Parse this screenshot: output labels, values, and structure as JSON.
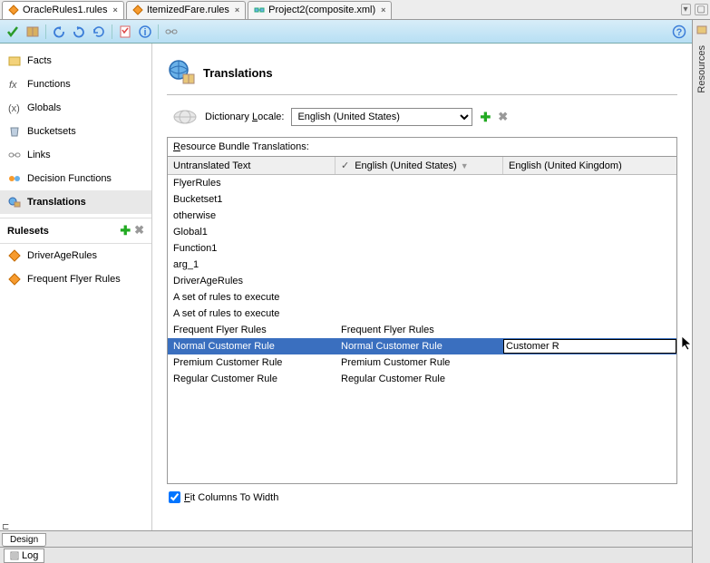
{
  "tabs": [
    {
      "label": "OracleRules1.rules",
      "active": true,
      "dirty": true,
      "icon": "rules"
    },
    {
      "label": "ItemizedFare.rules",
      "active": false,
      "dirty": false,
      "icon": "rules"
    },
    {
      "label": "Project2(composite.xml)",
      "active": false,
      "dirty": false,
      "icon": "composite"
    }
  ],
  "rightStrip": {
    "label": "Resources"
  },
  "leftNav": {
    "items": [
      {
        "label": "Facts",
        "icon": "facts"
      },
      {
        "label": "Functions",
        "icon": "functions"
      },
      {
        "label": "Globals",
        "icon": "globals"
      },
      {
        "label": "Bucketsets",
        "icon": "bucketsets"
      },
      {
        "label": "Links",
        "icon": "links"
      },
      {
        "label": "Decision Functions",
        "icon": "decisionfn"
      },
      {
        "label": "Translations",
        "icon": "translations",
        "selected": true
      }
    ],
    "rulesetsHeader": "Rulesets",
    "rulesets": [
      {
        "label": "DriverAgeRules"
      },
      {
        "label": "Frequent Flyer Rules"
      }
    ]
  },
  "content": {
    "title": "Translations",
    "localeLabel": "Dictionary Locale:",
    "localeSelected": "English (United States)",
    "tableTitle": "Resource Bundle Translations:",
    "titleMnemonic": "R",
    "columns": [
      "Untranslated Text",
      "English (United States)",
      "English (United Kingdom)"
    ],
    "checkedColumnIndex": 1,
    "rows": [
      {
        "c1": "FlyerRules",
        "c2": "",
        "c3": ""
      },
      {
        "c1": "Bucketset1",
        "c2": "",
        "c3": ""
      },
      {
        "c1": "otherwise",
        "c2": "",
        "c3": ""
      },
      {
        "c1": "Global1",
        "c2": "",
        "c3": ""
      },
      {
        "c1": "Function1",
        "c2": "",
        "c3": ""
      },
      {
        "c1": "arg_1",
        "c2": "",
        "c3": ""
      },
      {
        "c1": "DriverAgeRules",
        "c2": "",
        "c3": ""
      },
      {
        "c1": "A set of rules to execute",
        "c2": "",
        "c3": ""
      },
      {
        "c1": "A set of rules to execute",
        "c2": "",
        "c3": ""
      },
      {
        "c1": "Frequent Flyer Rules",
        "c2": "Frequent Flyer Rules",
        "c3": ""
      },
      {
        "c1": "Normal Customer Rule",
        "c2": "Normal Customer Rule",
        "c3": "Customer R",
        "selected": true,
        "editing": true
      },
      {
        "c1": "Premium Customer Rule",
        "c2": "Premium Customer Rule",
        "c3": ""
      },
      {
        "c1": "Regular Customer Rule",
        "c2": "Regular Customer Rule",
        "c3": ""
      }
    ],
    "fitColumnsLabel": "Fit Columns To Width",
    "fitColumnsMnemonic": "F",
    "fitColumnsChecked": true
  },
  "bottomTabs": {
    "designLabel": "Design"
  },
  "logBar": {
    "logLabel": "Log"
  }
}
